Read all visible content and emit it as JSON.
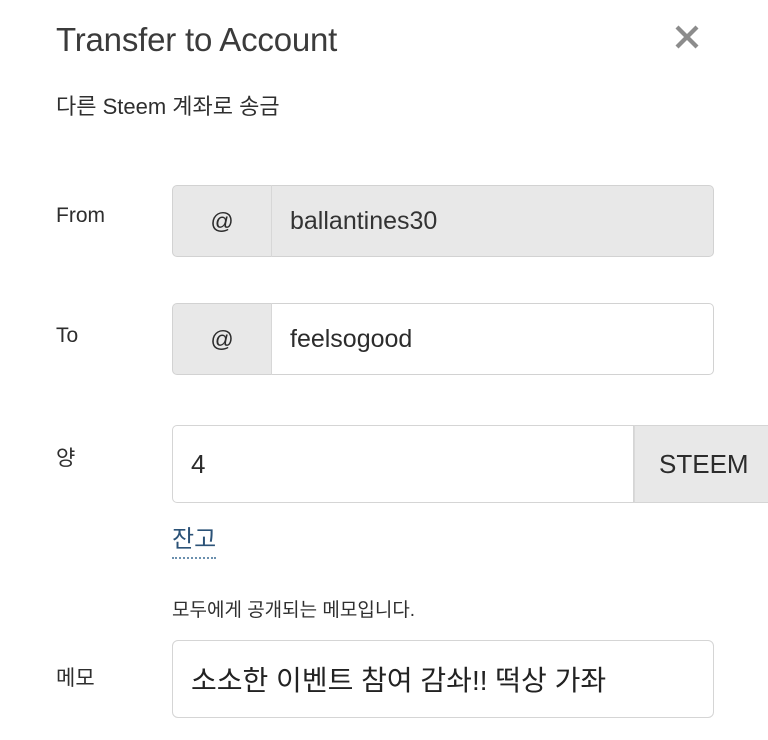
{
  "dialog": {
    "title": "Transfer to Account",
    "subtitle": "다른 Steem 계좌로 송금",
    "close_label": "×"
  },
  "form": {
    "from": {
      "label": "From",
      "prefix": "@",
      "value": "ballantines30",
      "placeholder": ""
    },
    "to": {
      "label": "To",
      "prefix": "@",
      "value": "feelsogood",
      "placeholder": ""
    },
    "amount": {
      "label": "양",
      "value": "4",
      "placeholder": "",
      "currency": "STEEM",
      "balance_link": "잔고"
    },
    "memo": {
      "label": "메모",
      "hint": "모두에게 공개되는 메모입니다.",
      "value": "소소한 이벤트 참여 감솨!! 떡상 가좌",
      "placeholder": ""
    }
  },
  "colors": {
    "background": "#ffffff",
    "text": "#2e2e2e",
    "title": "#3b3b3b",
    "field_border": "#d2d2d2",
    "field_disabled_bg": "#e8e8e8",
    "link": "#2b5277",
    "close_icon": "#8c8c8c"
  }
}
